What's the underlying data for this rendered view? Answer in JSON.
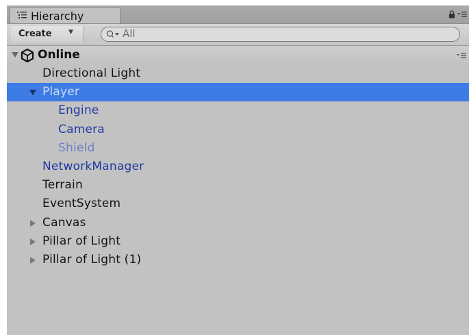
{
  "tab": {
    "title": "Hierarchy",
    "icon": "hierarchy-list-icon"
  },
  "toolbar": {
    "create_label": "Create",
    "search_value": "All",
    "search_icon": "search-filter-icon"
  },
  "scene": {
    "name": "Online",
    "icon": "unity-scene-icon",
    "expanded": true
  },
  "tree": [
    {
      "label": "Directional Light",
      "depth": 1,
      "color": "black",
      "foldout": "none",
      "selected": false
    },
    {
      "label": "Player",
      "depth": 1,
      "color": "white",
      "foldout": "expanded",
      "selected": true
    },
    {
      "label": "Engine",
      "depth": 2,
      "color": "blue",
      "foldout": "none",
      "selected": false
    },
    {
      "label": "Camera",
      "depth": 2,
      "color": "blue",
      "foldout": "none",
      "selected": false
    },
    {
      "label": "Shield",
      "depth": 2,
      "color": "faded",
      "foldout": "none",
      "selected": false
    },
    {
      "label": "NetworkManager",
      "depth": 1,
      "color": "blue",
      "foldout": "none",
      "selected": false
    },
    {
      "label": "Terrain",
      "depth": 1,
      "color": "black",
      "foldout": "none",
      "selected": false
    },
    {
      "label": "EventSystem",
      "depth": 1,
      "color": "black",
      "foldout": "none",
      "selected": false
    },
    {
      "label": "Canvas",
      "depth": 1,
      "color": "black",
      "foldout": "collapsed",
      "selected": false
    },
    {
      "label": "Pillar of Light",
      "depth": 1,
      "color": "black",
      "foldout": "collapsed",
      "selected": false
    },
    {
      "label": "Pillar of Light (1)",
      "depth": 1,
      "color": "black",
      "foldout": "collapsed",
      "selected": false
    }
  ],
  "colors": {
    "panel_bg": "#c2c2c2",
    "selection": "#3e7ce5",
    "prefab_blue": "#1f3aa3",
    "inactive_prefab": "#6f80c8"
  }
}
